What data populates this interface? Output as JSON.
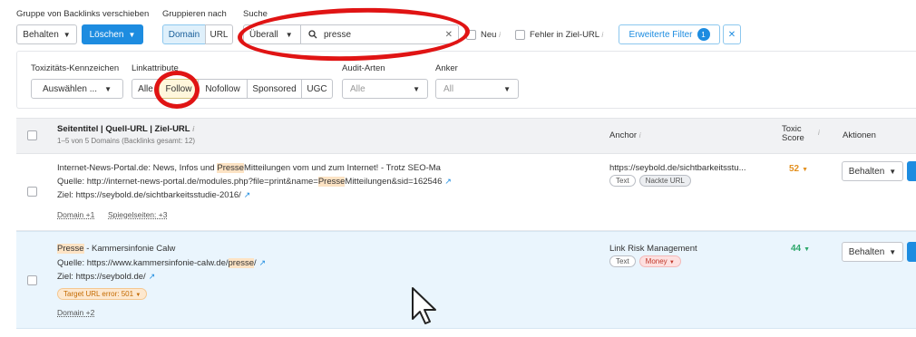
{
  "toolbar": {
    "group_label": "Gruppe von Backlinks verschieben",
    "groupby_label": "Gruppieren nach",
    "search_label": "Suche",
    "keep_btn": "Behalten",
    "delete_btn": "Löschen",
    "domain_btn": "Domain",
    "url_btn": "URL",
    "scope": "Überall",
    "search_value": "presse",
    "clear": "✕",
    "new_label": "Neu",
    "error_label": "Fehler in Ziel-URL",
    "adv_filter": "Erweiterte Filter",
    "adv_count": "1",
    "adv_close": "✕"
  },
  "filters": {
    "toxicity_label": "Toxizitäts-Kennzeichen",
    "linktype_label": "Linkattribute",
    "select_placeholder": "Auswählen ...",
    "link_types": [
      "Alle",
      "Follow",
      "Nofollow",
      "Sponsored",
      "UGC"
    ],
    "audit_label": "Audit-Arten",
    "audit_value": "Alle",
    "anchor_label": "Anker",
    "anchor_value": "All"
  },
  "table": {
    "col_title": "Seitentitel | Quell-URL | Ziel-URL",
    "col_title_sub": "1–5 von 5 Domains (Backlinks gesamt: 12)",
    "col_anchor": "Anchor",
    "col_toxic_1": "Toxic",
    "col_toxic_2": "Score",
    "col_actions": "Aktionen",
    "rows": [
      {
        "title_pre": "Internet-News-Portal.de: News, Infos und ",
        "title_hl": "Presse",
        "title_post": "Mitteilungen vom und zum Internet! - Trotz SEO-Ma",
        "source_label": "Quelle: ",
        "source_pre": "http://internet-news-portal.de/modules.php?file=print&name=",
        "source_hl": "Presse",
        "source_post": "Mitteilungen&sid=162546",
        "target_label": "Ziel: ",
        "target_url": "https://seybold.de/sichtbarkeitsstudie-2016/",
        "domain_more": "Domain +1",
        "mirror_pages": "Spiegelseiten: +3",
        "anchor": "https://seybold.de/sichtbarkeitsstu...",
        "tags": [
          "Text",
          "Nackte URL"
        ],
        "score": "52",
        "action": "Behalten"
      },
      {
        "title_hl": "Presse",
        "title_post": " - Kammersinfonie Calw",
        "source_label": "Quelle: ",
        "source_pre": "https://www.kammersinfonie-calw.de/",
        "source_hl": "presse",
        "source_post": "/",
        "target_label": "Ziel: ",
        "target_url": "https://seybold.de/",
        "target_error": "Target URL error: 501",
        "domain_more": "Domain +2",
        "anchor": "Link Risk Management",
        "tags": [
          "Text",
          "Money"
        ],
        "score": "44",
        "action": "Behalten"
      }
    ]
  },
  "colors": {
    "accent": "#1d8ce0",
    "annotation": "#e01414"
  }
}
